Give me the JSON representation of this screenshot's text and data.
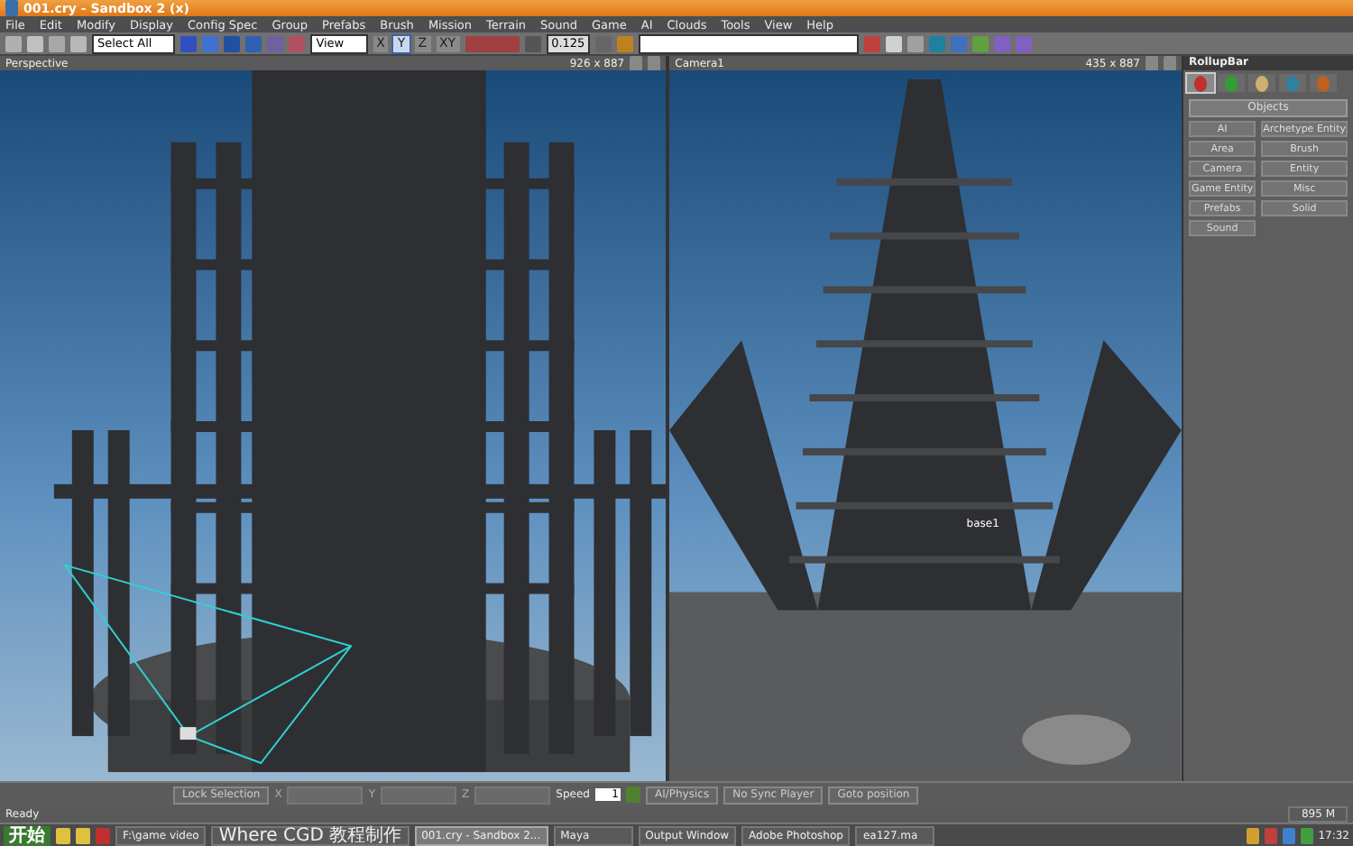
{
  "window": {
    "title": "001.cry - Sandbox 2 (x)"
  },
  "menu": [
    "File",
    "Edit",
    "Modify",
    "Display",
    "Config Spec",
    "Group",
    "Prefabs",
    "Brush",
    "Mission",
    "Terrain",
    "Sound",
    "Game",
    "AI",
    "Clouds",
    "Tools",
    "View",
    "Help"
  ],
  "toolbar": {
    "selection": "Select All",
    "coordinate_system": "View",
    "axes": [
      {
        "label": "X",
        "selected": false
      },
      {
        "label": "Y",
        "selected": true
      },
      {
        "label": "Z",
        "selected": false
      },
      {
        "label": "XY",
        "selected": false
      }
    ],
    "snap": "0.125"
  },
  "viewports": [
    {
      "title": "Perspective",
      "size": "926 x 887"
    },
    {
      "title": "Camera1",
      "size": "435 x 887",
      "labels": [
        "base1"
      ]
    }
  ],
  "rollup": {
    "title": "RollupBar",
    "tabs": [
      {
        "selected": true
      },
      {
        "selected": false
      },
      {
        "selected": false
      },
      {
        "selected": false
      },
      {
        "selected": false
      }
    ],
    "header": "Objects",
    "buttons": [
      "AI",
      "Archetype Entity",
      "Area",
      "Brush",
      "Camera",
      "Entity",
      "Game Entity",
      "Misc",
      "Prefabs",
      "Solid",
      "Sound"
    ]
  },
  "bottom_bar": {
    "lock": "Lock Selection",
    "coords": [
      "X",
      "Y",
      "Z"
    ],
    "speed_label": "Speed",
    "speed": "1",
    "buttons": [
      "AI/Physics",
      "No Sync Player",
      "Goto position"
    ]
  },
  "status_bar": {
    "text": "Ready",
    "memory": "895 M"
  },
  "taskbar": {
    "start": "开始",
    "tasks": [
      {
        "label": "F:\\game video",
        "selected": false
      },
      {
        "label": "Where CGD 教程制作",
        "selected": false
      },
      {
        "label": "001.cry - Sandbox 2...",
        "selected": true
      },
      {
        "label": "Maya",
        "selected": false
      },
      {
        "label": "Output Window",
        "selected": false
      },
      {
        "label": "Adobe Photoshop",
        "selected": false
      },
      {
        "label": "ea127.ma",
        "selected": false
      }
    ],
    "clock": "17:32"
  }
}
